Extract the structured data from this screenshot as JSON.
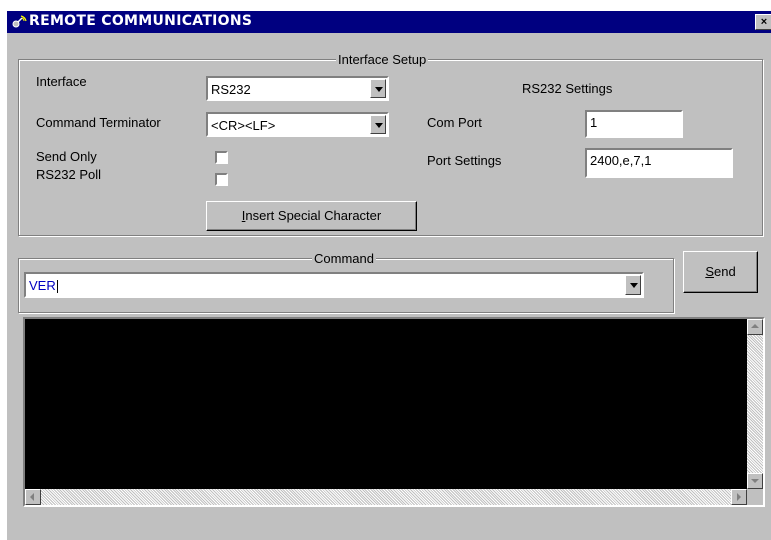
{
  "window": {
    "title": "REMOTE COMMUNICATIONS",
    "close_label": "×",
    "title_icon": "satellite-icon"
  },
  "interface_setup": {
    "group_label": "Interface Setup",
    "interface_label": "Interface",
    "interface_value": "RS232",
    "terminator_label": "Command Terminator",
    "terminator_value": "<CR><LF>",
    "send_only_label": "Send Only",
    "send_only_checked": false,
    "rs232_poll_label": "RS232 Poll",
    "rs232_poll_checked": false,
    "insert_button_accel": "I",
    "insert_button_rest": "nsert Special Character"
  },
  "rs232_settings": {
    "title": "RS232 Settings",
    "com_port_label": "Com Port",
    "com_port_value": "1",
    "port_settings_label": "Port Settings",
    "port_settings_value": "2400,e,7,1"
  },
  "command": {
    "group_label": "Command",
    "value": "VER",
    "send_accel": "S",
    "send_rest": "end"
  },
  "colors": {
    "titlebar": "#000080",
    "face": "#c0c0c0",
    "output_bg": "#000000",
    "command_text": "#0000c0"
  }
}
